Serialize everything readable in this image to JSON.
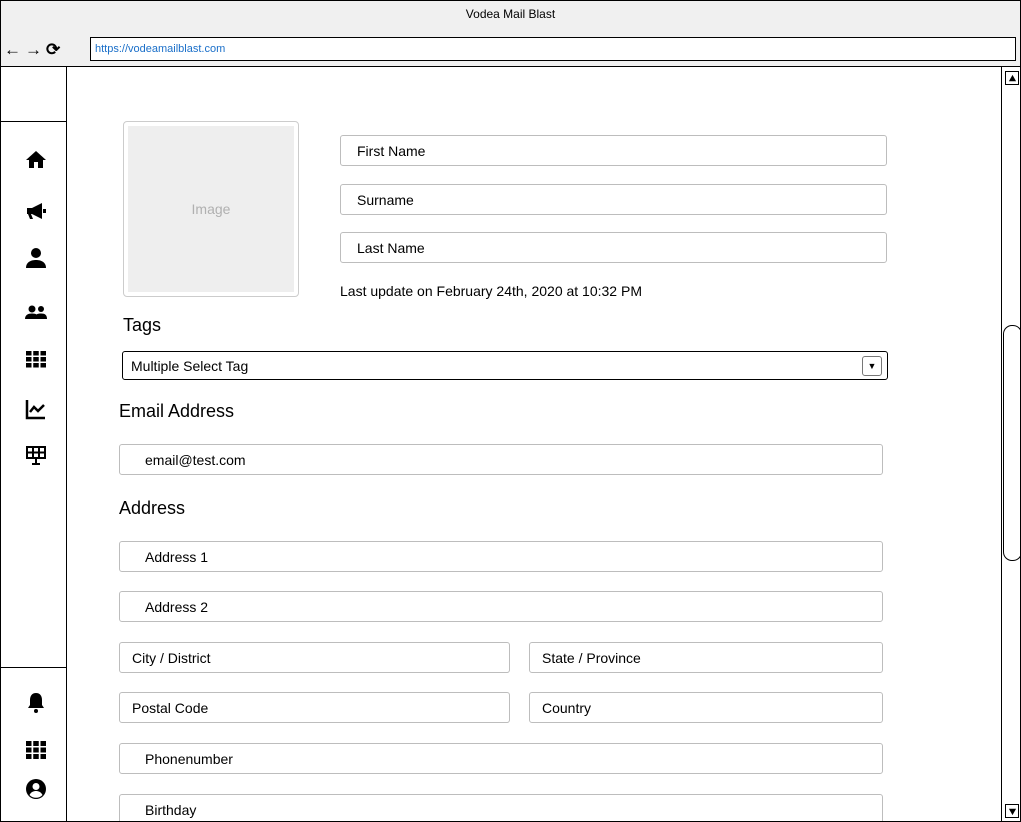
{
  "window": {
    "title": "Vodea Mail Blast",
    "url": "https://vodeamailblast.com"
  },
  "nav": {
    "back_icon": "arrow-left-icon",
    "forward_icon": "arrow-right-icon",
    "reload_icon": "reload-icon",
    "back": "←",
    "forward": "→",
    "reload": "⟳"
  },
  "sidebar": {
    "top_items": [
      "home-icon",
      "megaphone-icon",
      "user-icon",
      "users-icon",
      "grid-icon",
      "chart-icon",
      "presentation-icon"
    ],
    "bottom_items": [
      "bell-icon",
      "apps-icon",
      "account-circle-icon"
    ]
  },
  "profile": {
    "image_label": "Image",
    "first_name": "First Name",
    "surname": "Surname",
    "last_name": "Last Name",
    "last_update": "Last update on February 24th, 2020 at 10:32 PM"
  },
  "tags": {
    "heading": "Tags",
    "select_value": "Multiple Select Tag"
  },
  "email": {
    "heading": "Email Address",
    "value": "email@test.com"
  },
  "address": {
    "heading": "Address",
    "address1": "Address 1",
    "address2": "Address 2",
    "city": "City / District",
    "state": "State / Province",
    "postal": "Postal Code",
    "country": "Country",
    "phone": "Phonenumber",
    "birthday": "Birthday"
  }
}
